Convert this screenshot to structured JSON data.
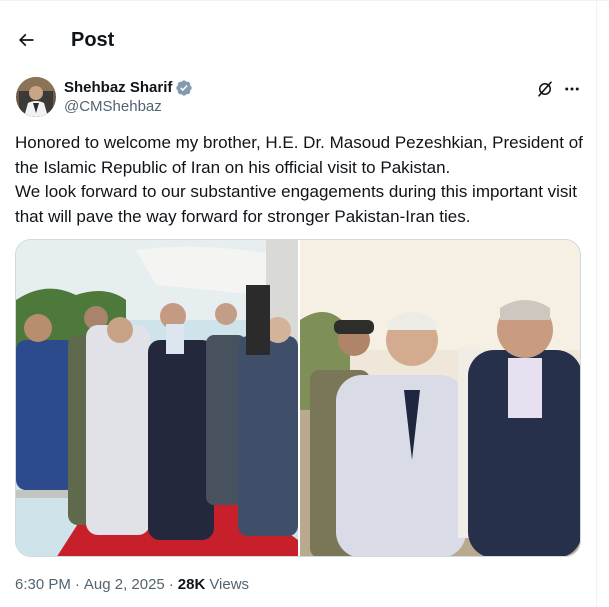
{
  "header": {
    "title": "Post",
    "back_icon": "arrow-left-icon"
  },
  "post": {
    "author_name": "Shehbaz Sharif",
    "author_handle": "@CMShehbaz",
    "verified": true,
    "verified_color": "#829aab",
    "text": "Honored to welcome my brother, H.E. Dr. Masoud Pezeshkian, President of the Islamic Republic of Iran on his official visit to Pakistan.\nWe look forward to our substantive engagements during this important visit that will pave the way forward for stronger Pakistan-Iran ties.",
    "media_count": 2
  },
  "meta": {
    "time": "6:30 PM",
    "separator": "·",
    "date": "Aug 2, 2025",
    "views_count": "28K",
    "views_label": "Views"
  },
  "colors": {
    "text": "#0f1419",
    "secondary": "#536471",
    "border": "#cfd9de",
    "carpet": "#c8202b"
  }
}
